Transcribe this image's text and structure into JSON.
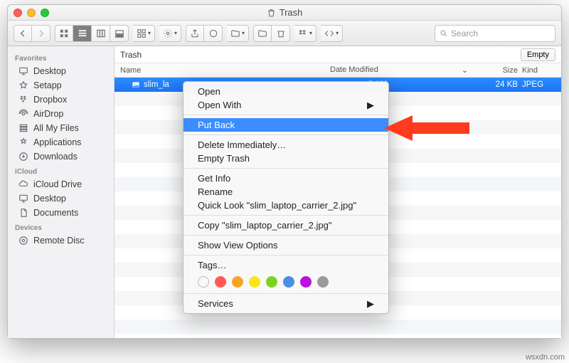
{
  "window": {
    "title": "Trash"
  },
  "toolbar": {
    "search_placeholder": "Search"
  },
  "sidebar": {
    "sections": [
      {
        "heading": "Favorites",
        "items": [
          {
            "icon": "desktop",
            "label": "Desktop"
          },
          {
            "icon": "star",
            "label": "Setapp"
          },
          {
            "icon": "dropbox",
            "label": "Dropbox"
          },
          {
            "icon": "airdrop",
            "label": "AirDrop"
          },
          {
            "icon": "allfiles",
            "label": "All My Files"
          },
          {
            "icon": "apps",
            "label": "Applications"
          },
          {
            "icon": "downloads",
            "label": "Downloads"
          }
        ]
      },
      {
        "heading": "iCloud",
        "items": [
          {
            "icon": "icloud",
            "label": "iCloud Drive"
          },
          {
            "icon": "desktop",
            "label": "Desktop"
          },
          {
            "icon": "documents",
            "label": "Documents"
          }
        ]
      },
      {
        "heading": "Devices",
        "items": [
          {
            "icon": "disc",
            "label": "Remote Disc"
          }
        ]
      }
    ]
  },
  "main": {
    "path": "Trash",
    "empty_button": "Empty",
    "columns": {
      "name": "Name",
      "date": "Date Modified",
      "size": "Size",
      "kind": "Kind"
    },
    "file": {
      "name": "slim_la",
      "date": "5 AM",
      "size": "24 KB",
      "kind": "JPEG"
    }
  },
  "context_menu": {
    "open": "Open",
    "open_with": "Open With",
    "put_back": "Put Back",
    "delete_immediately": "Delete Immediately…",
    "empty_trash": "Empty Trash",
    "get_info": "Get Info",
    "rename": "Rename",
    "quick_look": "Quick Look \"slim_laptop_carrier_2.jpg\"",
    "copy": "Copy \"slim_laptop_carrier_2.jpg\"",
    "show_view_options": "Show View Options",
    "tags": "Tags…",
    "tag_colors": [
      "#ff5a52",
      "#f6a623",
      "#f8e71c",
      "#7ed321",
      "#4a90e2",
      "#bd10e0",
      "#9b9b9b"
    ],
    "services": "Services"
  },
  "watermark": "wsxdn.com"
}
